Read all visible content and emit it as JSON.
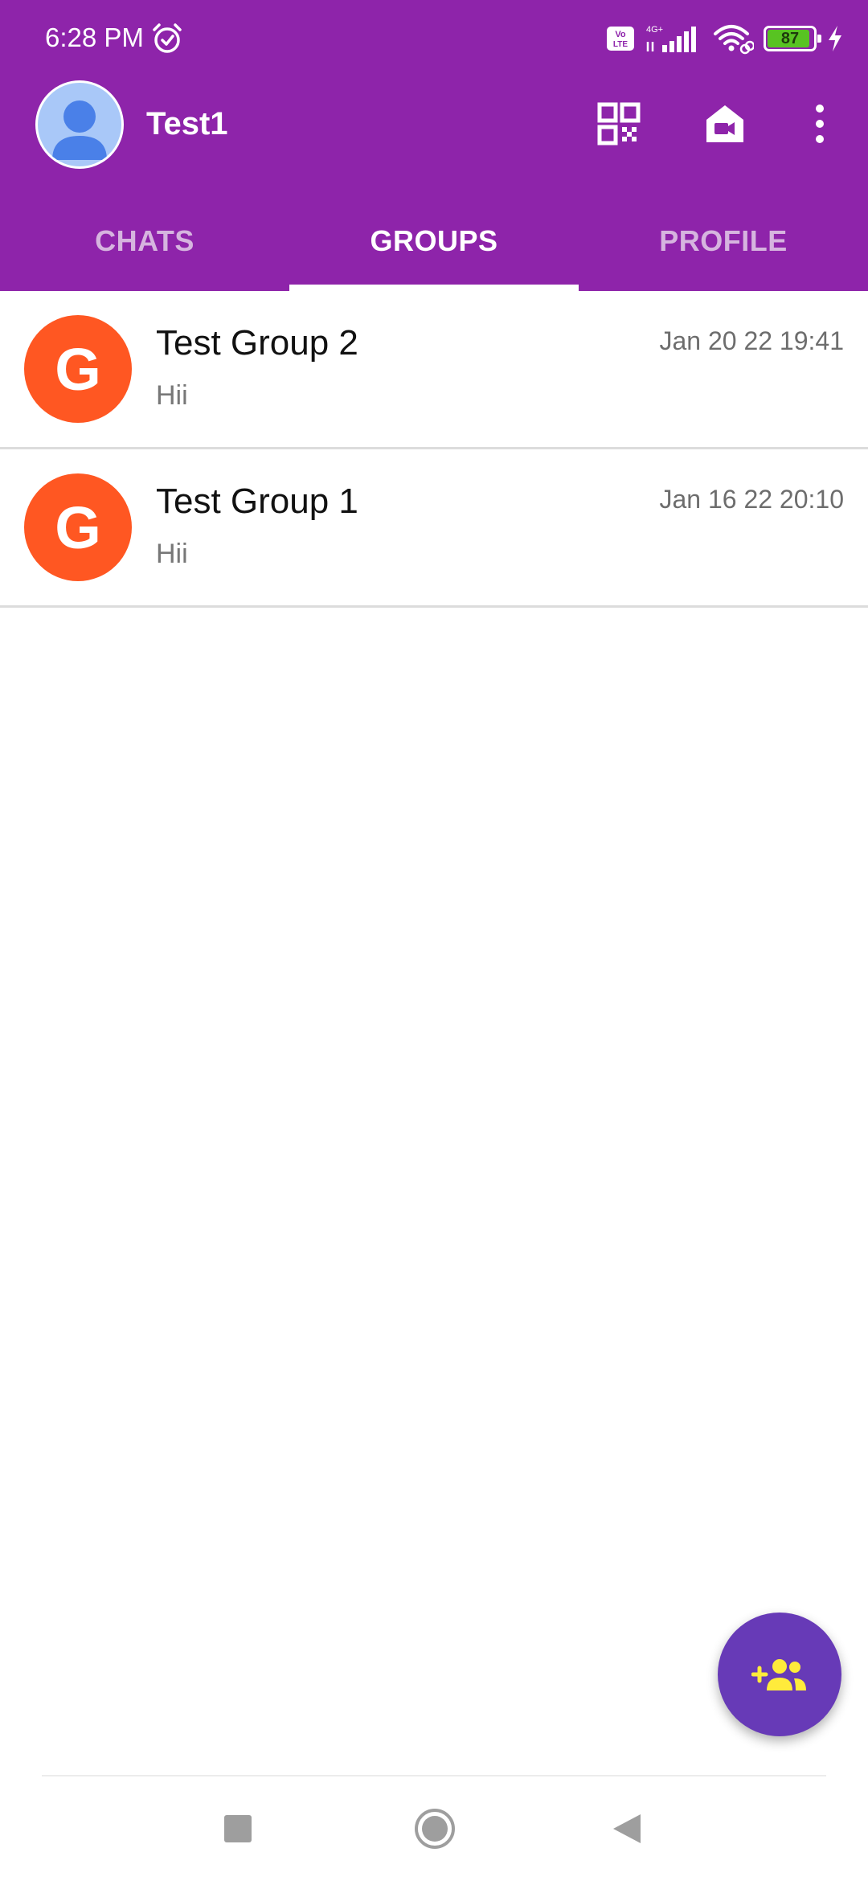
{
  "status_bar": {
    "time": "6:28 PM",
    "network": "4G+",
    "volte": "Vo LTE",
    "battery_level": "87",
    "battery_fraction": 0.87
  },
  "app_bar": {
    "user_name": "Test1",
    "icons": [
      "qr-code-icon",
      "video-home-icon",
      "more-vert-icon"
    ]
  },
  "tabs": [
    {
      "label": "CHATS",
      "active": false
    },
    {
      "label": "GROUPS",
      "active": true
    },
    {
      "label": "PROFILE",
      "active": false
    }
  ],
  "groups": [
    {
      "initial": "G",
      "name": "Test Group 2",
      "time": "Jan 20 22 19:41",
      "preview": "Hii"
    },
    {
      "initial": "G",
      "name": "Test Group 1",
      "time": "Jan 16 22 20:10",
      "preview": "Hii"
    }
  ],
  "fab": {
    "icon": "add-group-icon"
  },
  "colors": {
    "primary": "#8e24aa",
    "group_avatar": "#ff5722",
    "fab": "#673ab7",
    "fab_icon": "#ffeb3b"
  }
}
